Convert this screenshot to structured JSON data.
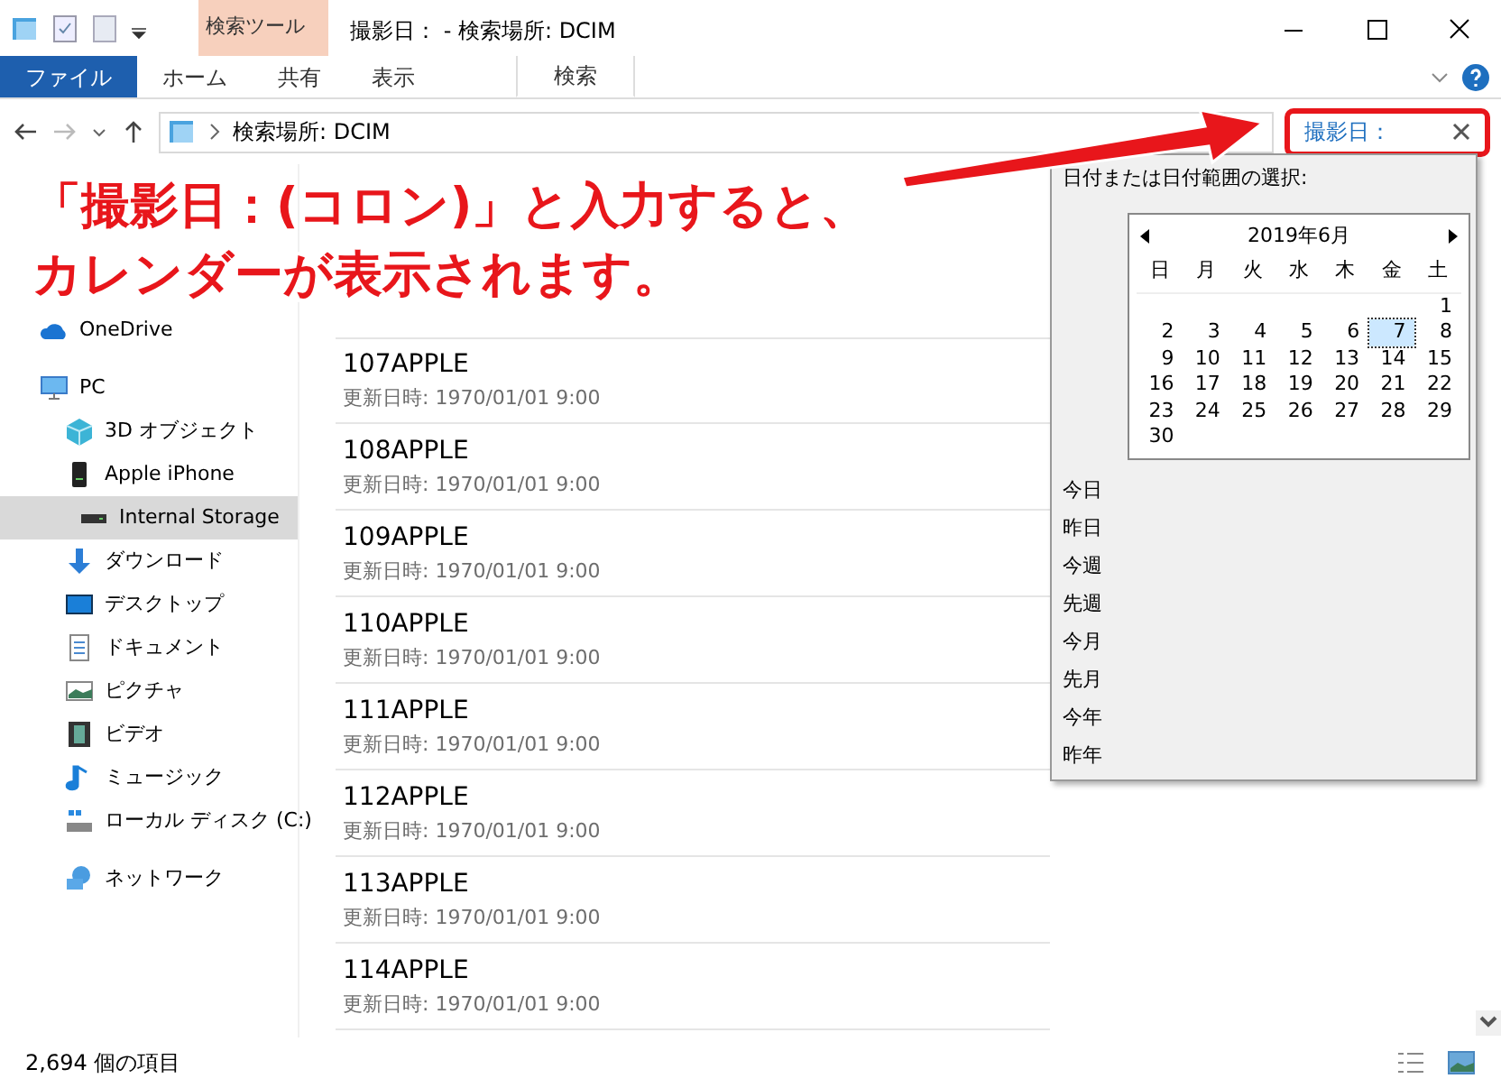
{
  "window": {
    "title": "撮影日： - 検索場所: DCIM",
    "contextual_tab_group": "検索ツール"
  },
  "ribbon_tabs": [
    {
      "label": "ファイル",
      "kind": "file",
      "selected": false
    },
    {
      "label": "ホーム",
      "kind": "tab",
      "selected": false
    },
    {
      "label": "共有",
      "kind": "tab",
      "selected": false
    },
    {
      "label": "表示",
      "kind": "tab",
      "selected": false
    },
    {
      "label": "検索",
      "kind": "context",
      "selected": true
    }
  ],
  "address_bar": {
    "path": "検索場所: DCIM"
  },
  "search": {
    "value": "撮影日："
  },
  "sidebar": {
    "items": [
      {
        "label": "OneDrive",
        "kind": "cloud"
      },
      {
        "label": "PC",
        "kind": "pc"
      },
      {
        "label": "3D オブジェクト",
        "kind": "cube"
      },
      {
        "label": "Apple iPhone",
        "kind": "phone",
        "children": [
          {
            "label": "Internal Storage",
            "kind": "drive",
            "selected": true
          }
        ]
      },
      {
        "label": "ダウンロード",
        "kind": "download"
      },
      {
        "label": "デスクトップ",
        "kind": "desktop"
      },
      {
        "label": "ドキュメント",
        "kind": "document"
      },
      {
        "label": "ピクチャ",
        "kind": "picture"
      },
      {
        "label": "ビデオ",
        "kind": "video"
      },
      {
        "label": "ミュージック",
        "kind": "music"
      },
      {
        "label": "ローカル ディスク (C:)",
        "kind": "disk"
      },
      {
        "label": "ネットワーク",
        "kind": "network"
      }
    ]
  },
  "files": [
    {
      "name": "107APPLE",
      "modified": "更新日時: 1970/01/01 9:00"
    },
    {
      "name": "108APPLE",
      "modified": "更新日時: 1970/01/01 9:00"
    },
    {
      "name": "109APPLE",
      "modified": "更新日時: 1970/01/01 9:00"
    },
    {
      "name": "110APPLE",
      "modified": "更新日時: 1970/01/01 9:00"
    },
    {
      "name": "111APPLE",
      "modified": "更新日時: 1970/01/01 9:00"
    },
    {
      "name": "112APPLE",
      "modified": "更新日時: 1970/01/01 9:00"
    },
    {
      "name": "113APPLE",
      "modified": "更新日時: 1970/01/01 9:00"
    },
    {
      "name": "114APPLE",
      "modified": "更新日時: 1970/01/01 9:00"
    }
  ],
  "date_popup": {
    "heading": "日付または日付範囲の選択:",
    "month": "2019年6月",
    "weekdays": [
      "日",
      "月",
      "火",
      "水",
      "木",
      "金",
      "土"
    ],
    "weeks": [
      {
        "kind": "trailing",
        "days": [
          {
            "day": "1",
            "selected": false
          }
        ]
      },
      {
        "kind": "full",
        "days": [
          {
            "day": "2",
            "selected": false
          },
          {
            "day": "3",
            "selected": false
          },
          {
            "day": "4",
            "selected": false
          },
          {
            "day": "5",
            "selected": false
          },
          {
            "day": "6",
            "selected": false
          },
          {
            "day": "7",
            "selected": true
          },
          {
            "day": "8",
            "selected": false
          }
        ]
      },
      {
        "kind": "full",
        "days": [
          {
            "day": "9",
            "selected": false
          },
          {
            "day": "10",
            "selected": false
          },
          {
            "day": "11",
            "selected": false
          },
          {
            "day": "12",
            "selected": false
          },
          {
            "day": "13",
            "selected": false
          },
          {
            "day": "14",
            "selected": false
          },
          {
            "day": "15",
            "selected": false
          }
        ]
      },
      {
        "kind": "full",
        "days": [
          {
            "day": "16",
            "selected": false
          },
          {
            "day": "17",
            "selected": false
          },
          {
            "day": "18",
            "selected": false
          },
          {
            "day": "19",
            "selected": false
          },
          {
            "day": "20",
            "selected": false
          },
          {
            "day": "21",
            "selected": false
          },
          {
            "day": "22",
            "selected": false
          }
        ]
      },
      {
        "kind": "full",
        "days": [
          {
            "day": "23",
            "selected": false
          },
          {
            "day": "24",
            "selected": false
          },
          {
            "day": "25",
            "selected": false
          },
          {
            "day": "26",
            "selected": false
          },
          {
            "day": "27",
            "selected": false
          },
          {
            "day": "28",
            "selected": false
          },
          {
            "day": "29",
            "selected": false
          }
        ]
      },
      {
        "kind": "leading",
        "days": [
          {
            "day": "30",
            "selected": false
          }
        ]
      }
    ],
    "ranges": [
      "今日",
      "昨日",
      "今週",
      "先週",
      "今月",
      "先月",
      "今年",
      "昨年"
    ]
  },
  "status_bar": {
    "count": "2,694 個の項目"
  },
  "annotation": {
    "lines": [
      "「撮影日：(コロン)」と入力すると、",
      "カレンダーが表示されます。"
    ]
  }
}
